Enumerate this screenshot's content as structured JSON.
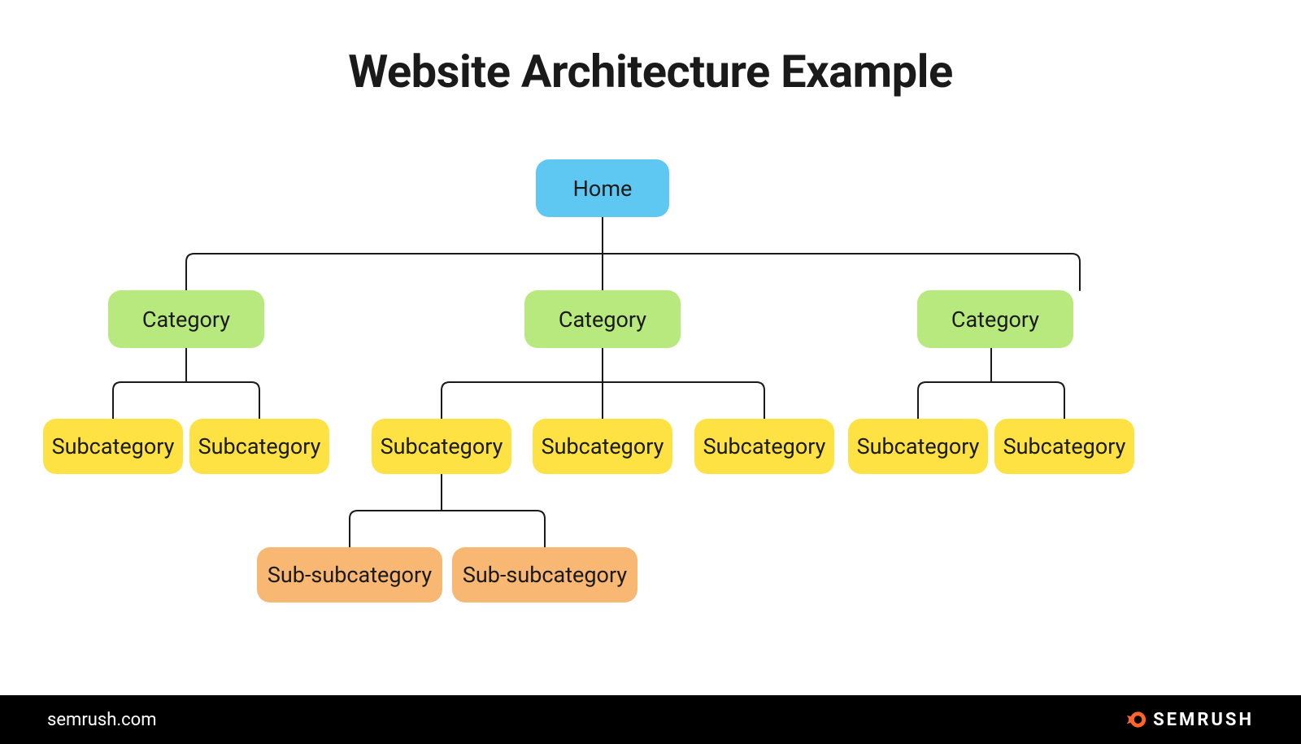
{
  "title": "Website Architecture Example",
  "footer": {
    "site": "semrush.com",
    "brand": "SEMRUSH"
  },
  "colors": {
    "home": "#5ec8f2",
    "category": "#b7e97e",
    "subcategory": "#fee244",
    "subsubcategory": "#f8b874",
    "accent": "#ff642d"
  },
  "nodes": {
    "home": {
      "label": "Home"
    },
    "categories": [
      {
        "label": "Category"
      },
      {
        "label": "Category"
      },
      {
        "label": "Category"
      }
    ],
    "subcategories": [
      {
        "label": "Subcategory"
      },
      {
        "label": "Subcategory"
      },
      {
        "label": "Subcategory"
      },
      {
        "label": "Subcategory"
      },
      {
        "label": "Subcategory"
      },
      {
        "label": "Subcategory"
      },
      {
        "label": "Subcategory"
      }
    ],
    "subsubcategories": [
      {
        "label": "Sub-subcategory"
      },
      {
        "label": "Sub-subcategory"
      }
    ]
  }
}
